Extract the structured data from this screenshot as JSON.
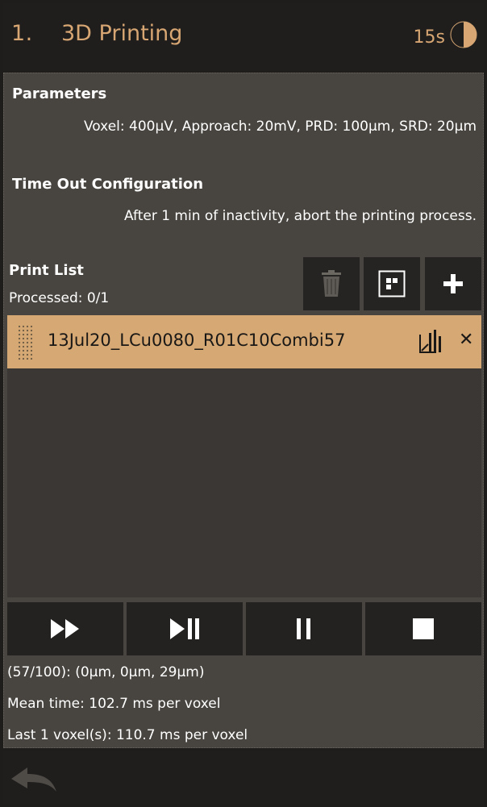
{
  "header": {
    "step": "1.",
    "title": "3D Printing",
    "timer": "15s"
  },
  "parameters": {
    "title": "Parameters",
    "text": "Voxel: 400µV, Approach: 20mV, PRD: 100µm, SRD: 20µm"
  },
  "timeout": {
    "title": "Time Out Configuration",
    "text": "After 1 min of inactivity, abort the printing process."
  },
  "print_list": {
    "title": "Print List",
    "processed": "Processed: 0/1",
    "items": [
      {
        "name": "13Jul20_LCu0080_R01C10Combi57"
      }
    ]
  },
  "toolbar": {
    "delete_icon": "trash-icon",
    "layout_icon": "grid-icon",
    "add_icon": "plus-icon"
  },
  "controls": {
    "icons": [
      "fast-forward-icon",
      "play-pause-icon",
      "pause-icon",
      "stop-icon"
    ]
  },
  "status": {
    "position": "(57/100): (0µm, 0µm, 29µm)",
    "mean_time": "Mean time: 102.7 ms per voxel",
    "last_voxel": "Last 1 voxel(s): 110.7 ms per voxel"
  },
  "colors": {
    "accent": "#d7a672",
    "panel": "#48443f",
    "item_bg": "#d5a874"
  }
}
